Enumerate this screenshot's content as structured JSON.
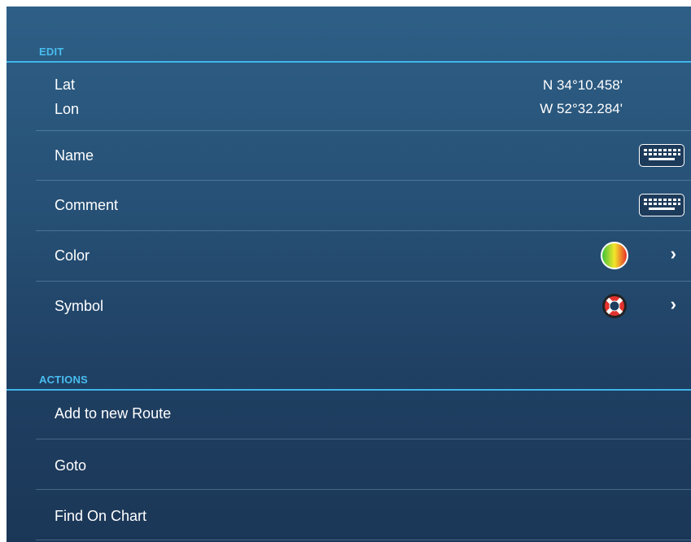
{
  "edit": {
    "header": "EDIT",
    "lat_label": "Lat",
    "lat_value": "N 34°10.458'",
    "lon_label": "Lon",
    "lon_value": "W 52°32.284'",
    "name_label": "Name",
    "comment_label": "Comment",
    "color_label": "Color",
    "symbol_label": "Symbol"
  },
  "actions": {
    "header": "ACTIONS",
    "items": [
      "Add to new Route",
      "Goto",
      "Find On Chart"
    ]
  },
  "icons": {
    "keyboard": "keyboard-icon",
    "color": "color-wheel-icon",
    "symbol": "lifebuoy-icon",
    "chevron": "chevron-right-icon"
  },
  "colors": {
    "accent": "#3fb6ea",
    "panel_top": "#2e5f86",
    "panel_bottom": "#1b3757"
  }
}
